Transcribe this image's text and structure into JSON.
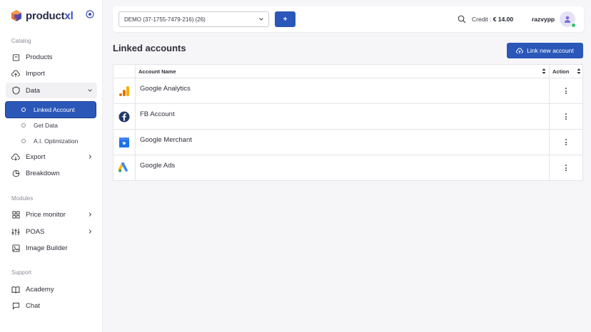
{
  "app": {
    "logo_text_main": "product",
    "logo_text_accent": "xl"
  },
  "sidebar": {
    "sections": {
      "catalog": "Catalog",
      "modules": "Modules",
      "support": "Support"
    },
    "items": {
      "products": "Products",
      "import": "Import",
      "data": "Data",
      "linked_account": "Linked Account",
      "get_data": "Get Data",
      "ai_optimization": "A.I. Optimization",
      "export": "Export",
      "breakdown": "Breakdown",
      "price_monitor": "Price monitor",
      "poas": "POAS",
      "image_builder": "Image Builder",
      "academy": "Academy",
      "chat": "Chat"
    }
  },
  "topbar": {
    "shop_selected": "DEMO (37-1755-7479-216) (26)",
    "add_label": "+",
    "credit_label": "Credit :",
    "credit_value": "€ 14.00",
    "username": "razvypp"
  },
  "main": {
    "title": "Linked accounts",
    "link_new_label": "Link new account",
    "table": {
      "col_name": "Account Name",
      "col_action": "Action",
      "rows": [
        {
          "name": "Google Analytics",
          "icon": "google-analytics-icon"
        },
        {
          "name": "FB Account",
          "icon": "facebook-icon"
        },
        {
          "name": "Google Merchant",
          "icon": "google-merchant-icon"
        },
        {
          "name": "Google Ads",
          "icon": "google-ads-icon"
        }
      ]
    }
  },
  "colors": {
    "primary": "#2b57b9",
    "status_online": "#2fc26b"
  }
}
